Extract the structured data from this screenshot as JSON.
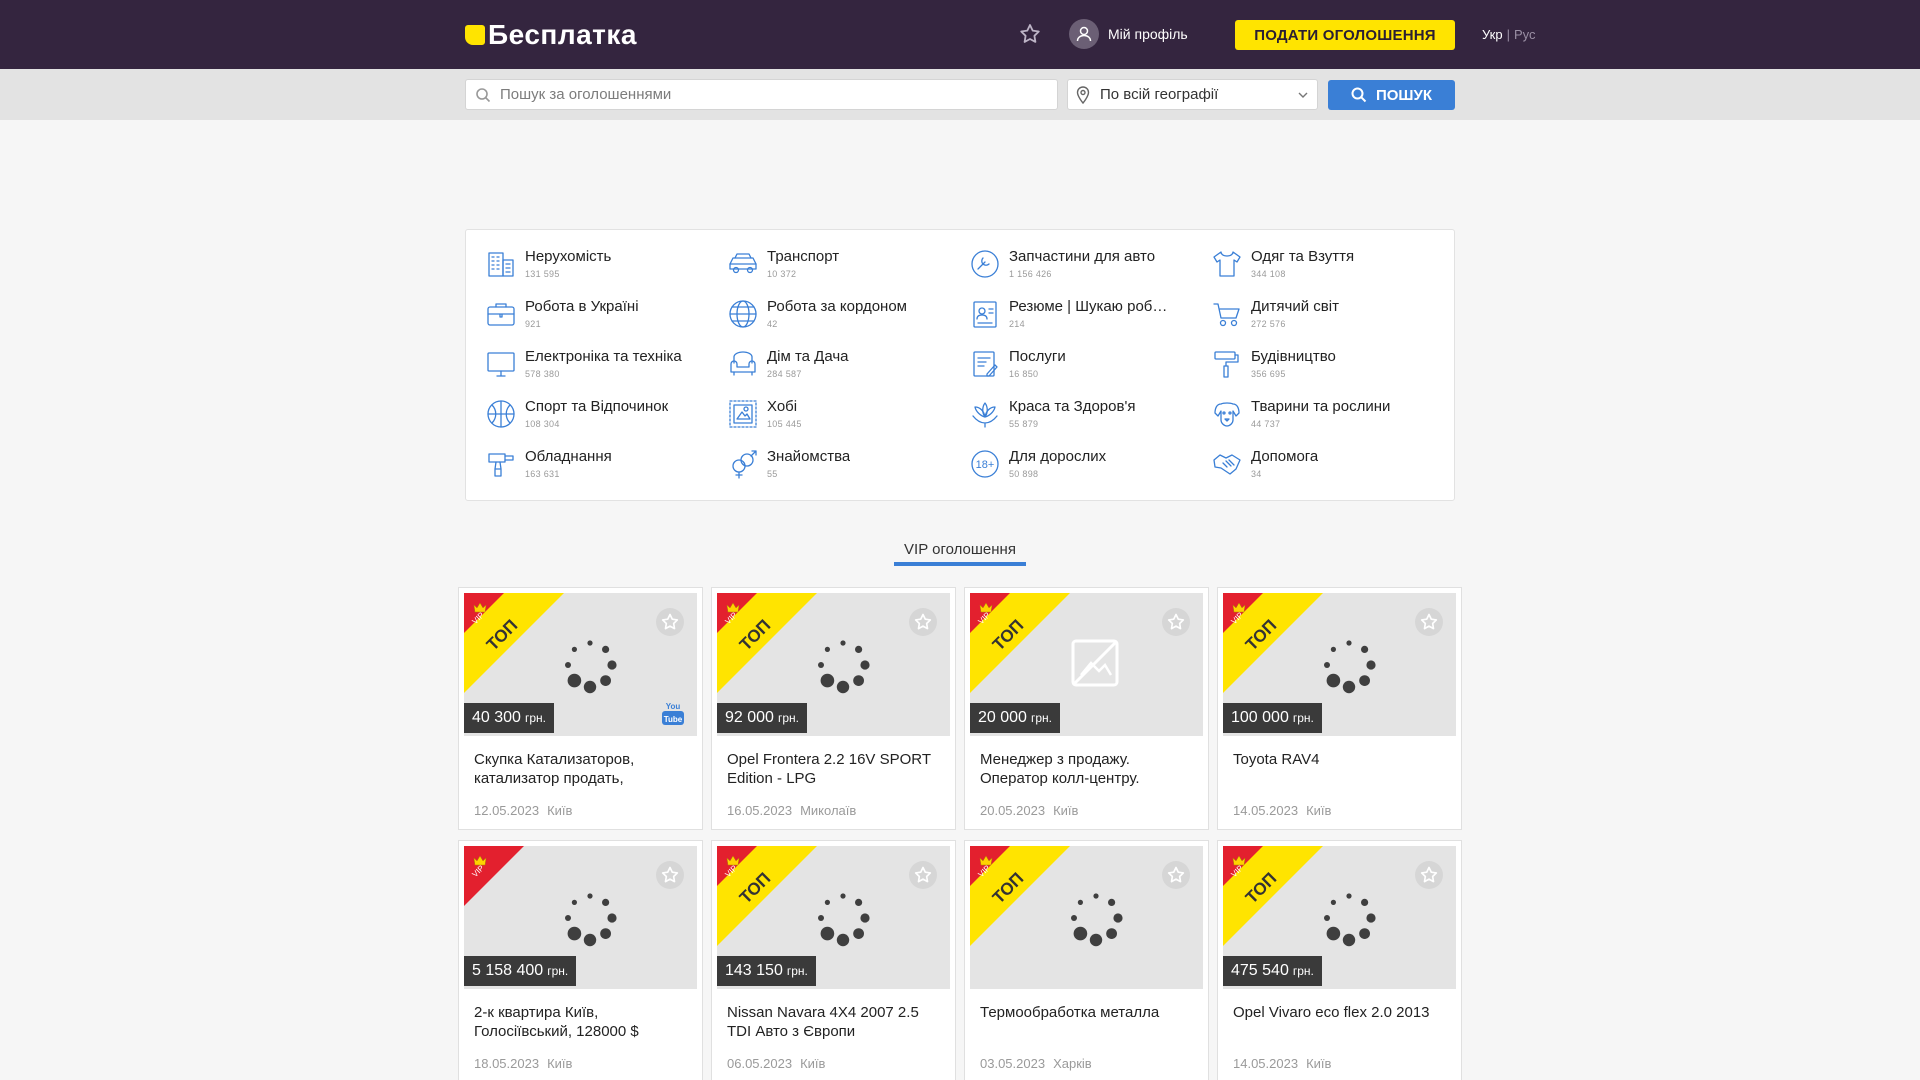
{
  "header": {
    "logo": "Бесплатка",
    "profile_label": "Мій профіль",
    "post_button": "ПОДАТИ ОГОЛОШЕННЯ",
    "lang_active": "Укр",
    "lang_sep": "|",
    "lang_inactive": "Рус"
  },
  "search": {
    "placeholder": "Пошук за оголошеннями",
    "geo_value": "По всій географії",
    "button": "ПОШУК"
  },
  "categories": [
    {
      "title": "Нерухомість",
      "count": "131 595",
      "icon": "building-icon"
    },
    {
      "title": "Транспорт",
      "count": "10 372",
      "icon": "car-icon"
    },
    {
      "title": "Запчастини для авто",
      "count": "1 156 426",
      "icon": "wrench-icon"
    },
    {
      "title": "Одяг та Взуття",
      "count": "344 108",
      "icon": "shirt-icon"
    },
    {
      "title": "Робота в Україні",
      "count": "921",
      "icon": "briefcase-icon"
    },
    {
      "title": "Робота за кордоном",
      "count": "42",
      "icon": "globe-icon"
    },
    {
      "title": "Резюме | Шукаю роб…",
      "count": "214",
      "icon": "resume-icon"
    },
    {
      "title": "Дитячий світ",
      "count": "272 576",
      "icon": "stroller-icon"
    },
    {
      "title": "Електроніка та техніка",
      "count": "578 380",
      "icon": "monitor-icon"
    },
    {
      "title": "Дім та Дача",
      "count": "284 587",
      "icon": "armchair-icon"
    },
    {
      "title": "Послуги",
      "count": "16 850",
      "icon": "services-icon"
    },
    {
      "title": "Будівництво",
      "count": "356 695",
      "icon": "paint-roller-icon"
    },
    {
      "title": "Спорт та Відпочинок",
      "count": "108 304",
      "icon": "ball-icon"
    },
    {
      "title": "Хобі",
      "count": "105 445",
      "icon": "stamp-icon"
    },
    {
      "title": "Краса та Здоров'я",
      "count": "55 879",
      "icon": "lotus-icon"
    },
    {
      "title": "Тварини та рослини",
      "count": "44 737",
      "icon": "dog-icon"
    },
    {
      "title": "Обладнання",
      "count": "163 631",
      "icon": "drill-icon"
    },
    {
      "title": "Знайомства",
      "count": "55",
      "icon": "gender-icon"
    },
    {
      "title": "Для дорослих",
      "count": "50 898",
      "icon": "adult-18-icon"
    },
    {
      "title": "Допомога",
      "count": "34",
      "icon": "handshake-icon"
    }
  ],
  "vip_heading": "VIP оголошення",
  "ribbon": {
    "vip": "VIP",
    "top": "ТОП"
  },
  "cards": [
    {
      "price": "40 300",
      "currency": "грн.",
      "title": "Скупка Катализаторов, катализатор продать,",
      "date": "12.05.2023",
      "city": "Київ",
      "top": true,
      "youtube": true,
      "nophoto": false
    },
    {
      "price": "92 000",
      "currency": "грн.",
      "title": "Opel Frontera 2.2 16V SPORT Edition - LPG",
      "date": "16.05.2023",
      "city": "Миколаїв",
      "top": true,
      "youtube": false,
      "nophoto": false
    },
    {
      "price": "20 000",
      "currency": "грн.",
      "title": "Менеджер з продажу. Оператор колл-центру.",
      "date": "20.05.2023",
      "city": "Київ",
      "top": true,
      "youtube": false,
      "nophoto": true
    },
    {
      "price": "100 000",
      "currency": "грн.",
      "title": "Toyota RAV4",
      "date": "14.05.2023",
      "city": "Київ",
      "top": true,
      "youtube": false,
      "nophoto": false
    },
    {
      "price": "5 158 400",
      "currency": "грн.",
      "title": "2-к квартира Київ, Голосіївський, 128000 $",
      "date": "18.05.2023",
      "city": "Київ",
      "top": false,
      "youtube": false,
      "nophoto": false
    },
    {
      "price": "143 150",
      "currency": "грн.",
      "title": "Nissan Navara 4X4 2007 2.5 TDI Авто з Європи",
      "date": "06.05.2023",
      "city": "Київ",
      "top": true,
      "youtube": false,
      "nophoto": false
    },
    {
      "price": "",
      "currency": "",
      "title": "Термообработка металла",
      "date": "03.05.2023",
      "city": "Харків",
      "top": true,
      "youtube": false,
      "nophoto": false
    },
    {
      "price": "475 540",
      "currency": "грн.",
      "title": "Opel Vivaro eco flex 2.0 2013",
      "date": "14.05.2023",
      "city": "Київ",
      "top": true,
      "youtube": false,
      "nophoto": false
    }
  ],
  "colors": {
    "header_bg": "#34253f",
    "accent_yellow": "#ffe400",
    "accent_blue": "#3a7fd6",
    "vip_red": "#e3202e"
  }
}
